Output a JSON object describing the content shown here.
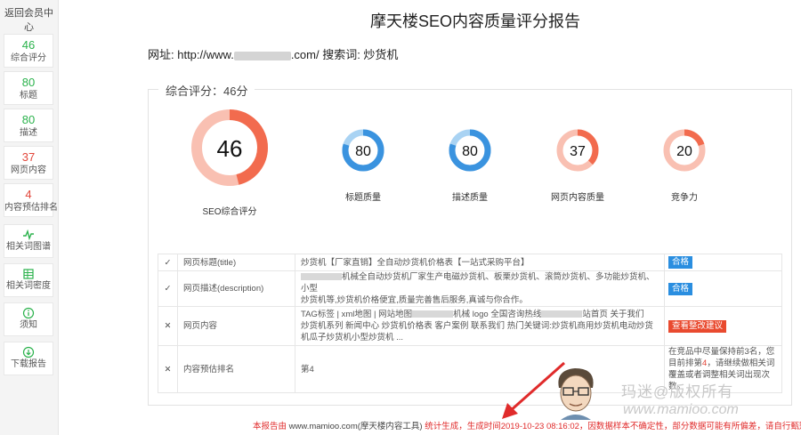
{
  "sidebar": {
    "back_label": "返回会员中心",
    "items": [
      {
        "value": "46",
        "label": "综合评分",
        "color": "#2bb24c"
      },
      {
        "value": "80",
        "label": "标题",
        "color": "#2bb24c"
      },
      {
        "value": "80",
        "label": "描述",
        "color": "#2bb24c"
      },
      {
        "value": "37",
        "label": "网页内容",
        "color": "#e2463a"
      },
      {
        "value": "4",
        "label": "内容预估排名",
        "color": "#e2463a"
      },
      {
        "icon": "line-chart-icon",
        "label": "相关词图谱"
      },
      {
        "icon": "grid-icon",
        "label": "相关词密度"
      },
      {
        "icon": "info-icon",
        "label": "须知"
      },
      {
        "icon": "download-icon",
        "label": "下载报告"
      }
    ]
  },
  "report": {
    "title": "摩天楼SEO内容质量评分报告",
    "url_prefix": "网址: http://www.",
    "url_suffix": ".com/ 搜索词: 炒货机",
    "overall_legend": "综合评分：46分"
  },
  "gauges": [
    {
      "value": 46,
      "label": "SEO综合评分",
      "color": "#f26b4e",
      "track": "#f9c0b2"
    },
    {
      "value": 80,
      "label": "标题质量",
      "color": "#3a93df",
      "track": "#a9d3f3"
    },
    {
      "value": 80,
      "label": "描述质量",
      "color": "#3a93df",
      "track": "#a9d3f3"
    },
    {
      "value": 37,
      "label": "网页内容质量",
      "color": "#f26b4e",
      "track": "#f9c0b2"
    },
    {
      "value": 20,
      "label": "竞争力",
      "color": "#f26b4e",
      "track": "#f9c0b2"
    }
  ],
  "table": {
    "rows": [
      {
        "status": "ok",
        "name": "网页标题(title)",
        "content": "炒货机【厂家直销】全自动炒货机价格表【一站式采购平台】",
        "tag": "合格",
        "tag_color": "blue"
      },
      {
        "status": "ok",
        "name": "网页描述(description)",
        "content_a": "机械全自动炒货机厂家生产电磁炒货机、板栗炒货机、滚筒炒货机、多功能炒货机、小型",
        "content_b": "炒货机等,炒货机价格便宜,质量完善售后服务,真诚与你合作。",
        "tag": "合格",
        "tag_color": "blue"
      },
      {
        "status": "bad",
        "name": "网页内容",
        "content_a": "TAG标签 | xml地图 | 网站地图",
        "content_b": "机械 logo 全国咨询热线",
        "content_c": "站首页 关于我们",
        "content_d": "炒货机系列 新闻中心 炒货机价格表 客户案例 联系我们 热门关键词:炒货机商用炒货机电动炒货",
        "content_e": "机瓜子炒货机小型炒货机 ...",
        "tag": "查看整改建议",
        "tag_color": "red"
      },
      {
        "status": "bad",
        "name": "内容预估排名",
        "content": "第4",
        "note_a": "在竞品中尽量保持前3名，您目前排第",
        "note_rank": "4",
        "note_b": "，请继续做相关词覆盖或者调整相关词出现次数。"
      }
    ]
  },
  "footer": {
    "part1": "本报告由",
    "part2": " www.mamioo.com(摩天楼内容工具) ",
    "part3": "统计生成，生成时间2019-10-23 08:16:02，因数据样本不确定性，部分数据可能有所偏差，请自行甄别"
  },
  "watermark": {
    "text": "玛迷@版权所有",
    "url": "www.mamioo.com"
  }
}
